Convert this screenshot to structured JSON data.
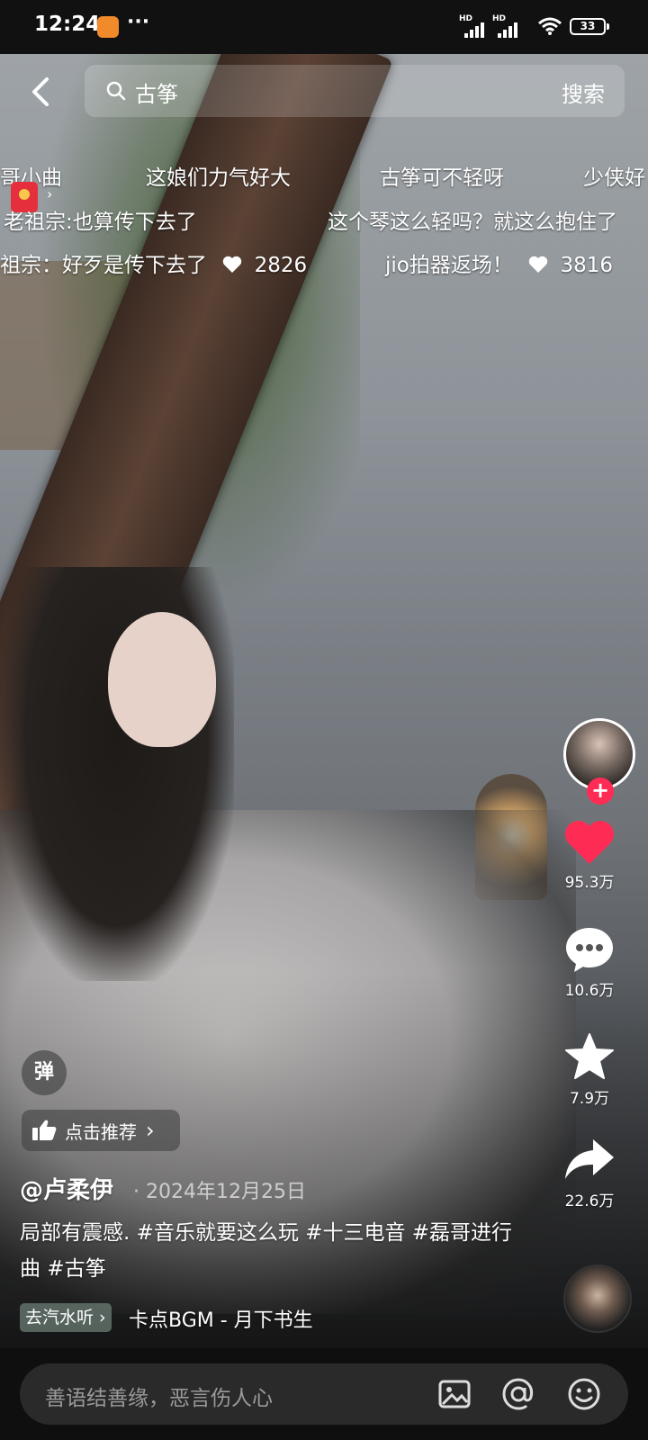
{
  "status_bar": {
    "time": "12:24",
    "more_dots": "···",
    "network_label": "HD",
    "battery_level": "33"
  },
  "search": {
    "query": "古筝",
    "button_label": "搜索"
  },
  "danmaku": {
    "row1": [
      "哥小曲",
      "这娘们力气好大",
      "古筝可不轻呀",
      "少侠好"
    ],
    "row2": [
      "老祖宗:也算传下去了",
      "这个琴这么轻吗？就这么抱住了"
    ],
    "row3": [
      {
        "text": "祖宗：好歹是传下去了",
        "likes": "2826"
      },
      {
        "text": "jio拍器返场！",
        "likes": "3816"
      }
    ]
  },
  "redpacket_arrow": "›",
  "actions": {
    "follow_symbol": "+",
    "like_count": "95.3万",
    "comment_count": "10.6万",
    "favorite_count": "7.9万",
    "share_count": "22.6万"
  },
  "danmu_toggle_label": "弹",
  "recommend": {
    "label": "点击推荐",
    "arrow": "›"
  },
  "post": {
    "author": "@卢柔伊",
    "separator": "·",
    "date": "2024年12月25日",
    "caption": "局部有震感. #音乐就要这么玩 #十三电音 #磊哥进行曲 #古筝"
  },
  "music": {
    "tag": "去汽水听 ›",
    "song": "卡点BGM - 月下书生"
  },
  "comment_bar": {
    "placeholder": "善语结善缘，恶言伤人心"
  },
  "colors": {
    "like": "#fe2c55",
    "follow": "#fe2c55"
  },
  "icons": [
    "back-icon",
    "search-icon",
    "heart-icon",
    "comment-icon",
    "star-icon",
    "share-icon",
    "image-icon",
    "at-icon",
    "emoji-icon",
    "thumbs-up-icon"
  ]
}
